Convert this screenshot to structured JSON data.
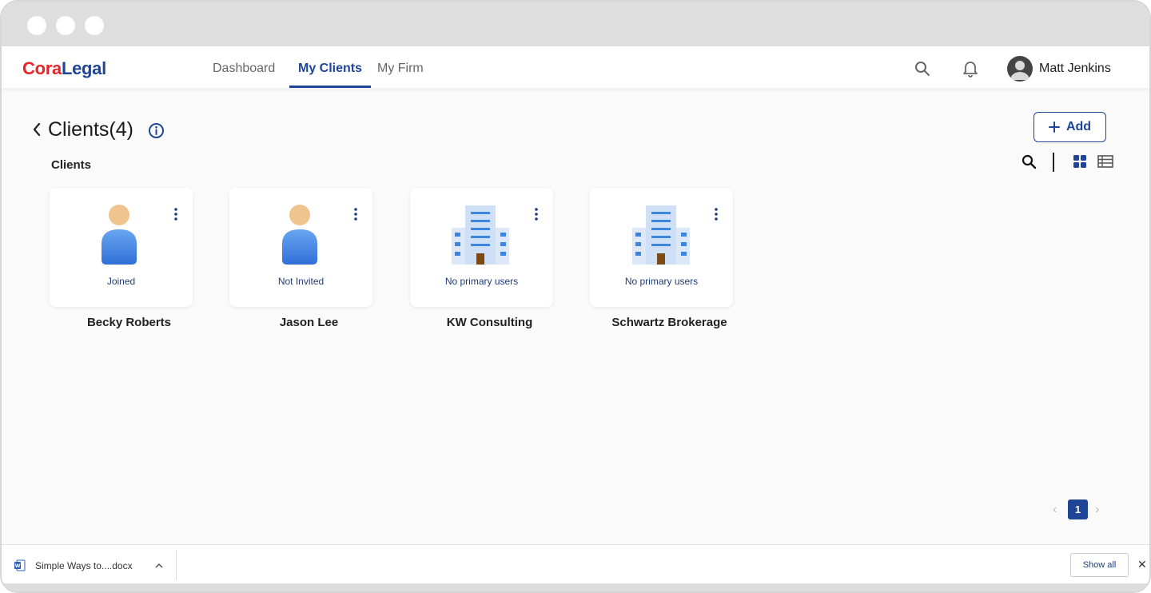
{
  "app": {
    "logo_part1": "Cora",
    "logo_part2": "Legal",
    "brand_color": "#1e4596",
    "accent_color": "#e5252a"
  },
  "nav": {
    "tabs": [
      {
        "label": "Dashboard",
        "active": false
      },
      {
        "label": "My Clients",
        "active": true
      },
      {
        "label": "My Firm",
        "active": false
      }
    ],
    "icons": [
      "search-icon",
      "bell-icon"
    ],
    "user_name": "Matt Jenkins"
  },
  "page": {
    "title": "Clients(4)",
    "section_label": "Clients",
    "add_label": "Add"
  },
  "clients": [
    {
      "name": "Becky Roberts",
      "status": "Joined",
      "type": "person"
    },
    {
      "name": "Jason Lee",
      "status": "Not Invited",
      "type": "person"
    },
    {
      "name": "KW Consulting",
      "status": "No primary users",
      "type": "company"
    },
    {
      "name": "Schwartz Brokerage",
      "status": "No primary users",
      "type": "company"
    }
  ],
  "pagination": {
    "current": "1",
    "prev": "‹",
    "next": "›"
  },
  "download_bar": {
    "file_name": "Simple Ways to....docx",
    "show_all_label": "Show all",
    "close": "✕"
  }
}
